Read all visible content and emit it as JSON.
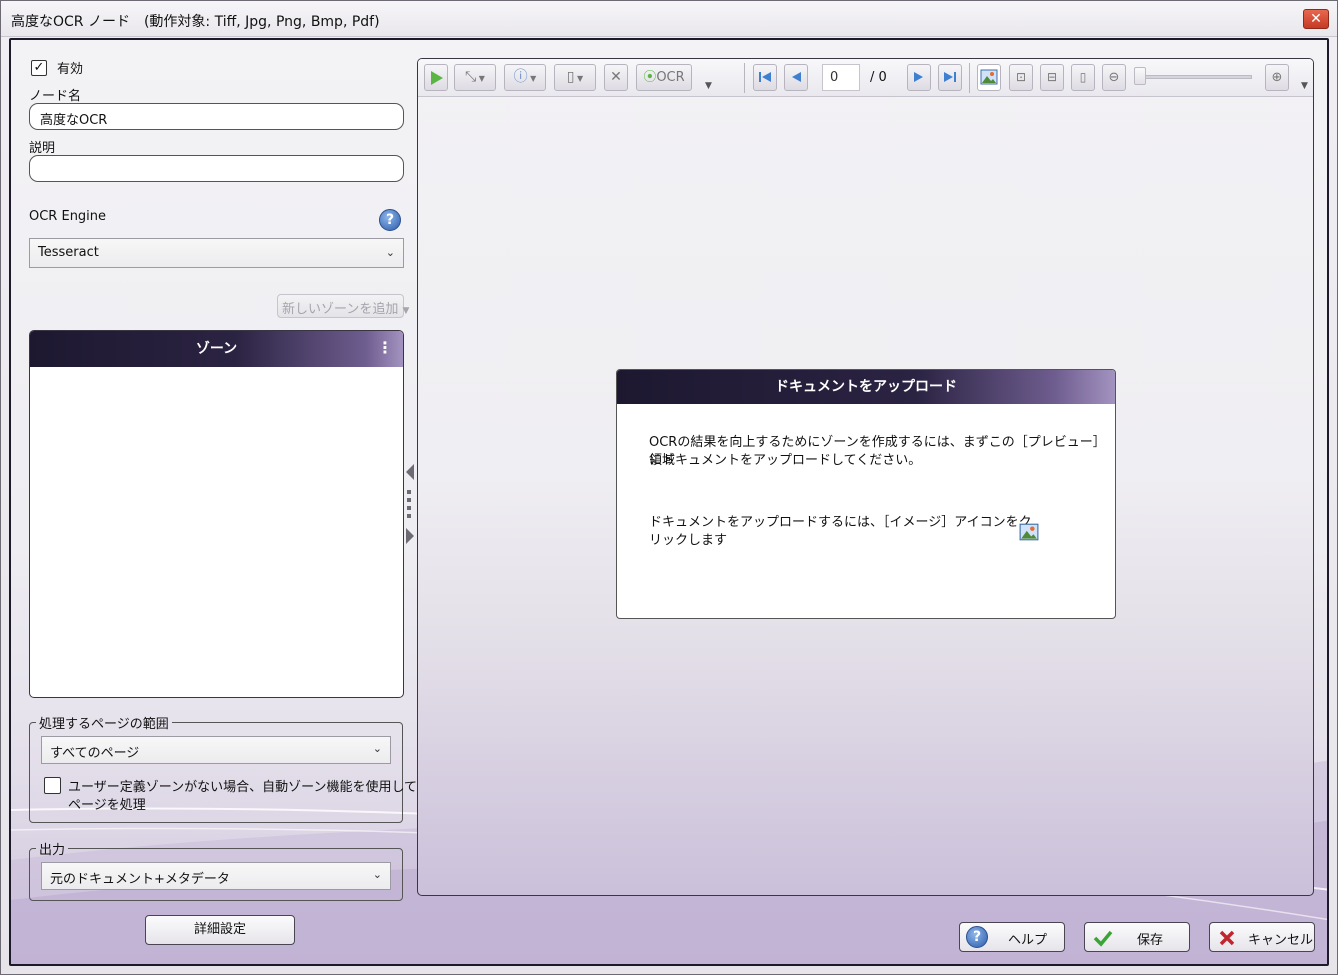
{
  "window": {
    "title": "高度なOCR ノード　(動作対象: Tiff, Jpg, Png, Bmp, Pdf)",
    "close_label": "✕"
  },
  "left": {
    "enabled_label": "有効",
    "enabled_checked": true,
    "node_name_label": "ノード名",
    "node_name_value": "高度なOCR",
    "description_label": "説明",
    "description_value": "",
    "engine_label": "OCR Engine",
    "engine_value": "Tesseract",
    "add_zone_label": "新しいゾーンを追加",
    "zones_header": "ゾーン",
    "page_range_legend": "処理するページの範囲",
    "page_range_value": "すべてのページ",
    "auto_zone_line1": "ユーザー定義ゾーンがない場合、自動ゾーン機能を使用して",
    "auto_zone_line2": "ページを処理",
    "auto_zone_checked": false,
    "output_legend": "出力",
    "output_value": "元のドキュメント+メタデータ",
    "advanced_label": "詳細設定"
  },
  "toolbar": {
    "ocr_label": "OCR",
    "page_current": "0",
    "page_total": "/  0"
  },
  "dialog": {
    "title": "ドキュメントをアップロード",
    "line1": "OCRの結果を向上するためにゾーンを作成するには、まずこの［プレビュー］領域",
    "line2": "にドキュメントをアップロードしてください。",
    "line3": "ドキュメントをアップロードするには、［イメージ］アイコンをク",
    "line4": "リックします"
  },
  "footer": {
    "help_label": "ヘルプ",
    "save_label": "保存",
    "cancel_label": "キャンセル"
  },
  "colors": {
    "header_dark": "#1d1830",
    "header_light": "#a393c0",
    "accent_green": "#3aa535",
    "cancel_red": "#c0262d"
  }
}
